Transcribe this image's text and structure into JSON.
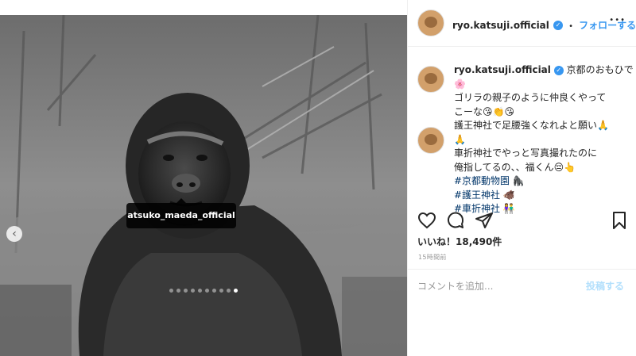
{
  "photo": {
    "tag_username": "atsuko_maeda_official",
    "carousel_total": 10,
    "carousel_active": 10
  },
  "header": {
    "username": "ryo.katsuji.official",
    "separator": "•",
    "follow_label": "フォローする",
    "more_label": "•••"
  },
  "caption": {
    "username": "ryo.katsuji.official",
    "lines": [
      "京都のおもひで",
      "🌸",
      "ゴリラの親子のように仲良くやって",
      "こーな😘👏😘",
      "護王神社で足腰強くなれよと願い🙏",
      "🙏",
      "車折神社でやっと写真撮れたのに",
      "俺指してるの、、福くん😔👆"
    ],
    "hashtags": [
      "#京都動物園 🦍",
      "#護王神社 🐗",
      "#車折神社 👫"
    ]
  },
  "likes": {
    "label": "いいね！18,490件"
  },
  "timestamp": "15時間前",
  "comment": {
    "placeholder": "コメントを追加...",
    "post_label": "投稿する"
  },
  "colors": {
    "accent": "#3897f0",
    "hashtag": "#003569",
    "muted": "#999999",
    "post_disabled": "#b2dffc"
  }
}
